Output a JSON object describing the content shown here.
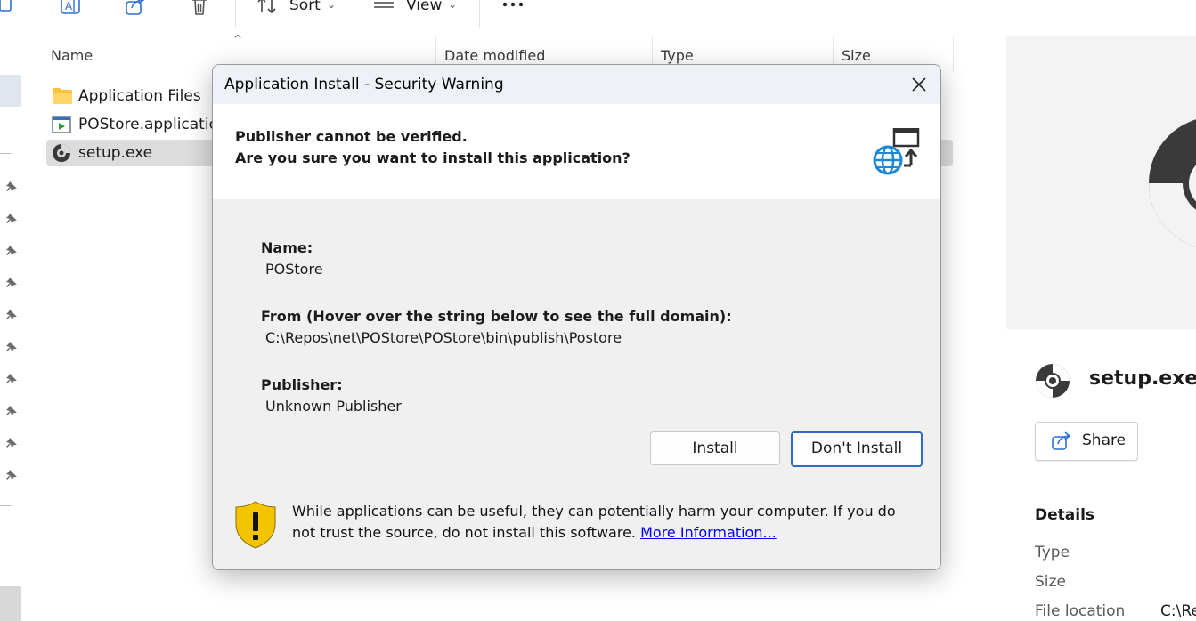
{
  "toolbar": {
    "sort_label": "Sort",
    "view_label": "View",
    "icons": [
      "rename-icon",
      "share-icon",
      "delete-icon",
      "sort-icon",
      "view-icon",
      "more-icon"
    ]
  },
  "file_list": {
    "columns": [
      "Name",
      "Date modified",
      "Type",
      "Size"
    ],
    "items": [
      {
        "name": "Application Files",
        "icon": "folder-icon"
      },
      {
        "name": "POStore.application",
        "icon": "application-manifest-icon"
      },
      {
        "name": "setup.exe",
        "icon": "setup-disc-icon",
        "selected": true
      }
    ]
  },
  "details_pane": {
    "file_name": "setup.exe",
    "share_label": "Share",
    "section_title": "Details",
    "fields": [
      "Type",
      "Size",
      "File location"
    ],
    "file_location_value": "C:\\Re"
  },
  "dialog": {
    "title": "Application Install - Security Warning",
    "heading_line1": "Publisher cannot be verified.",
    "heading_line2": "Are you sure you want to install this application?",
    "name_label": "Name:",
    "name_value": "POStore",
    "from_label": "From (Hover over the string below to see the full domain):",
    "from_value": "C:\\Repos\\net\\POStore\\POStore\\bin\\publish\\Postore",
    "publisher_label": "Publisher:",
    "publisher_value": "Unknown Publisher",
    "install_label": "Install",
    "dont_install_label": "Don't Install",
    "warning_text": "While applications can be useful, they can potentially harm your computer. If you do not trust the source, do not install this software.",
    "more_info_label": "More Information...",
    "colors": {
      "accent": "#2c6cc9",
      "shield": "#f5c400",
      "link": "#0000ee"
    }
  }
}
